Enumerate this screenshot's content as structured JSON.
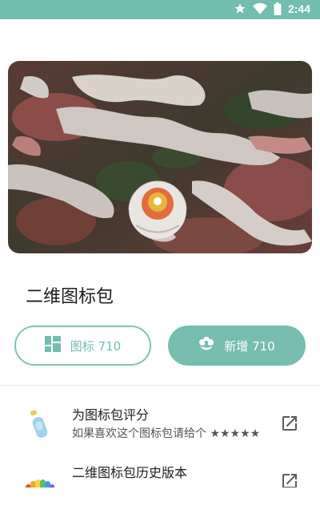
{
  "status_bar": {
    "time": "2:44",
    "icons": [
      "star-icon",
      "wifi-icon",
      "battery-icon"
    ],
    "color": "#72bdaf"
  },
  "hero": {
    "image": "aerial photo of hot air balloon over rocky valley"
  },
  "app": {
    "title": "二维图标包"
  },
  "buttons": {
    "icons": {
      "label": "图标 710",
      "icon": "grid-icon"
    },
    "new": {
      "label": "新增 710",
      "icon": "flower-icon"
    }
  },
  "list": [
    {
      "title": "为图标包评分",
      "subtitle": "如果喜欢这个图标包请给个 ★★★★★",
      "icon": "bottle-icon",
      "action_icon": "open-external-icon"
    },
    {
      "title": "二维图标包历史版本",
      "subtitle": "",
      "icon": "rainbow-cloud-icon",
      "action_icon": "open-external-icon"
    }
  ],
  "colors": {
    "accent": "#72bdaf",
    "accent_light": "#7fc3b5"
  }
}
